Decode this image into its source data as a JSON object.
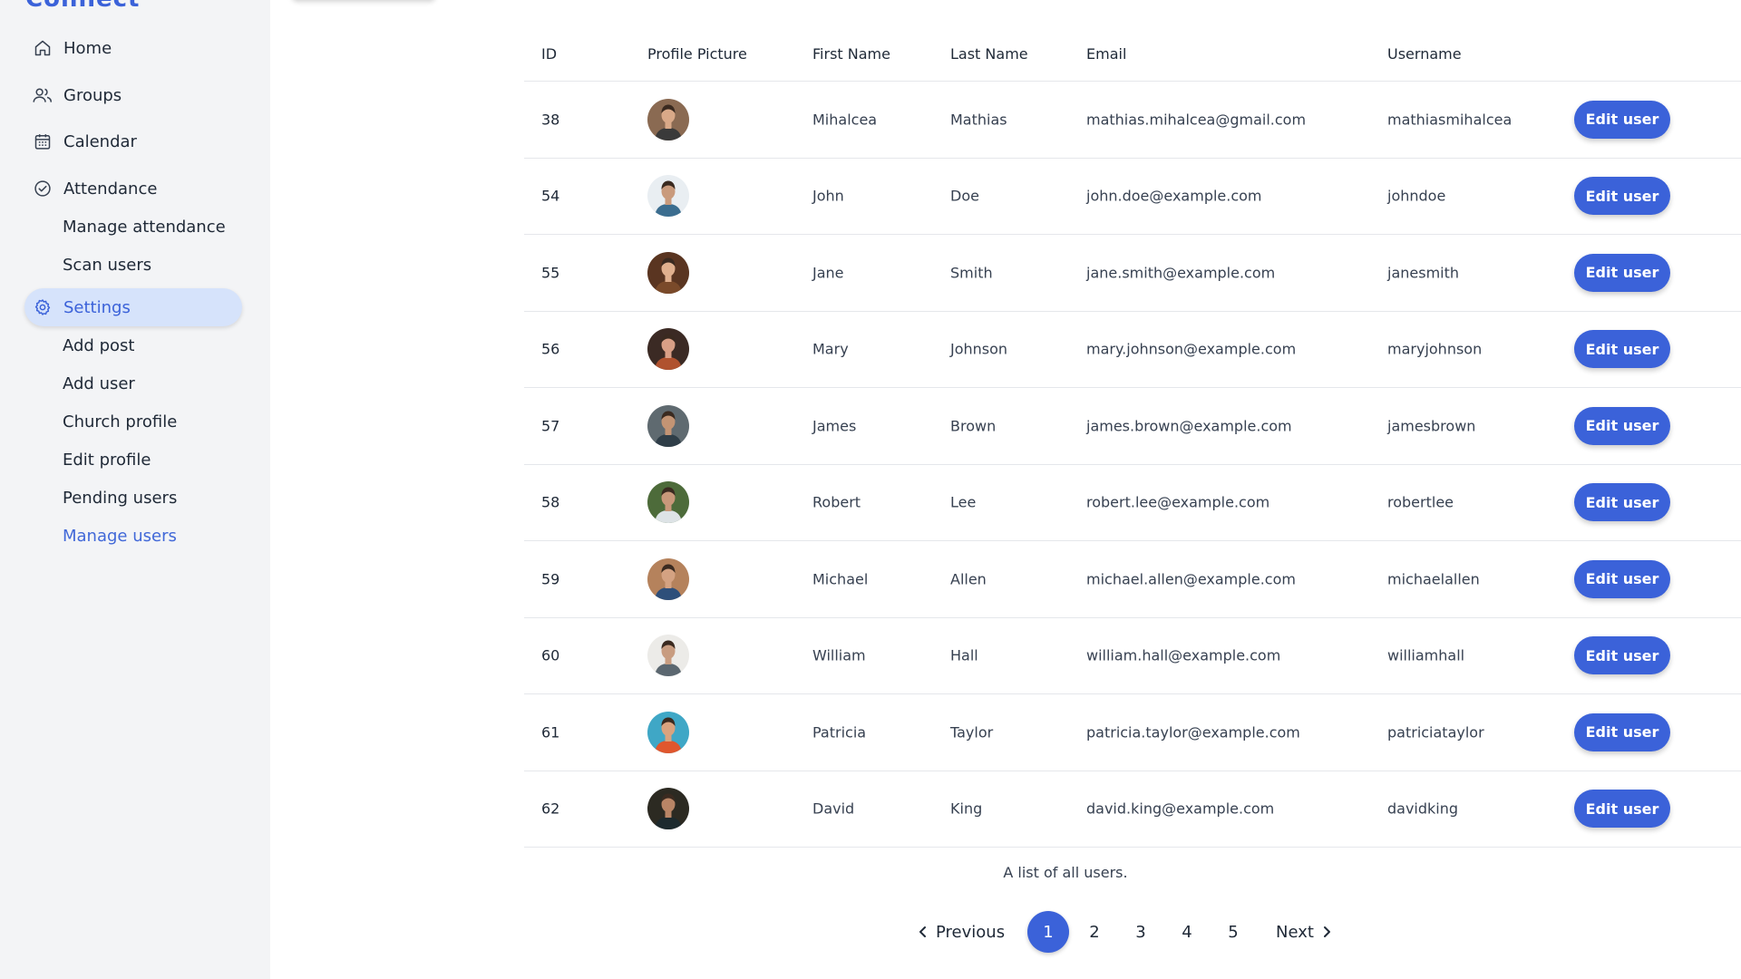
{
  "app": {
    "logo_fragment": "Connect"
  },
  "sidebar": {
    "items": [
      {
        "label": "Home",
        "icon": "home-icon"
      },
      {
        "label": "Groups",
        "icon": "users-icon"
      },
      {
        "label": "Calendar",
        "icon": "calendar-icon"
      },
      {
        "label": "Attendance",
        "icon": "check-circle-icon"
      },
      {
        "label": "Settings",
        "icon": "gear-icon"
      }
    ],
    "attendance_sub": [
      "Manage attendance",
      "Scan users"
    ],
    "settings_sub": [
      "Add post",
      "Add user",
      "Church profile",
      "Edit profile",
      "Pending users",
      "Manage users"
    ],
    "active_item": "Settings",
    "current_sub": "Manage users"
  },
  "table": {
    "headers": [
      "ID",
      "Profile Picture",
      "First Name",
      "Last Name",
      "Email",
      "Username"
    ],
    "edit_label": "Edit user",
    "rows": [
      {
        "id": "38",
        "first": "Mihalcea",
        "last": "Mathias",
        "email": "mathias.mihalcea@gmail.com",
        "username": "mathiasmihalcea",
        "avatar_bg": "#8a6a52",
        "skin": "#d9a988",
        "shirt": "#3a3a3a"
      },
      {
        "id": "54",
        "first": "John",
        "last": "Doe",
        "email": "john.doe@example.com",
        "username": "johndoe",
        "avatar_bg": "#e9eef2",
        "skin": "#c99a7c",
        "shirt": "#3b6d8f"
      },
      {
        "id": "55",
        "first": "Jane",
        "last": "Smith",
        "email": "jane.smith@example.com",
        "username": "janesmith",
        "avatar_bg": "#5a3521",
        "skin": "#e0b08e",
        "shirt": "#7a4a2a"
      },
      {
        "id": "56",
        "first": "Mary",
        "last": "Johnson",
        "email": "mary.johnson@example.com",
        "username": "maryjohnson",
        "avatar_bg": "#3b2a24",
        "skin": "#d99f86",
        "shirt": "#b0522f"
      },
      {
        "id": "57",
        "first": "James",
        "last": "Brown",
        "email": "james.brown@example.com",
        "username": "jamesbrown",
        "avatar_bg": "#5f6a70",
        "skin": "#c39474",
        "shirt": "#2f3e48"
      },
      {
        "id": "58",
        "first": "Robert",
        "last": "Lee",
        "email": "robert.lee@example.com",
        "username": "robertlee",
        "avatar_bg": "#4d6b3a",
        "skin": "#c8987a",
        "shirt": "#dde3e6"
      },
      {
        "id": "59",
        "first": "Michael",
        "last": "Allen",
        "email": "michael.allen@example.com",
        "username": "michaelallen",
        "avatar_bg": "#b5825c",
        "skin": "#d4a282",
        "shirt": "#2e4f7a"
      },
      {
        "id": "60",
        "first": "William",
        "last": "Hall",
        "email": "william.hall@example.com",
        "username": "williamhall",
        "avatar_bg": "#ecebe8",
        "skin": "#c89c80",
        "shirt": "#5b6770"
      },
      {
        "id": "61",
        "first": "Patricia",
        "last": "Taylor",
        "email": "patricia.taylor@example.com",
        "username": "patriciataylor",
        "avatar_bg": "#3fa7c6",
        "skin": "#d9a37f",
        "shirt": "#e0572e"
      },
      {
        "id": "62",
        "first": "David",
        "last": "King",
        "email": "david.king@example.com",
        "username": "davidking",
        "avatar_bg": "#2c2a22",
        "skin": "#b98566",
        "shirt": "#1d2a2e"
      }
    ],
    "caption": "A list of all users."
  },
  "pagination": {
    "prev_label": "Previous",
    "next_label": "Next",
    "pages": [
      "1",
      "2",
      "3",
      "4",
      "5"
    ],
    "current": "1"
  },
  "colors": {
    "accent": "#3b62d9",
    "sidebar_bg": "#f3f4f6",
    "active_bg": "#d6e3fb"
  }
}
